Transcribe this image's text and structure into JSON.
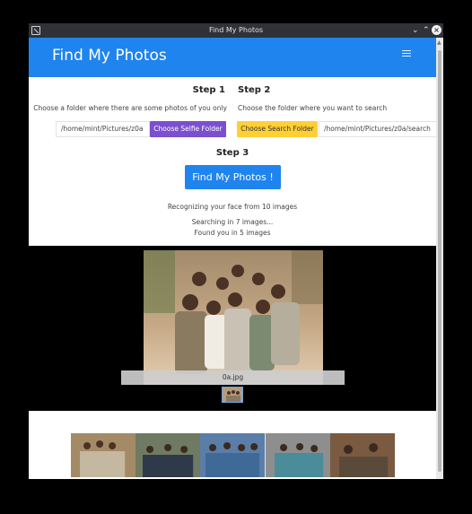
{
  "window": {
    "title": "Find My Photos"
  },
  "navbar": {
    "brand": "Find My Photos"
  },
  "step1": {
    "title": "Step 1",
    "description": "Choose a folder where there are some photos of you only",
    "path": "/home/mint/Pictures/z0a",
    "button": "Choose Selfie Folder"
  },
  "step2": {
    "title": "Step 2",
    "description": "Choose the folder where you want to search",
    "path": "/home/mint/Pictures/z0a/search",
    "button": "Choose Search Folder"
  },
  "step3": {
    "title": "Step 3",
    "button": "Find My Photos !"
  },
  "status": {
    "recognizing": "Recognizing your face from 10 images",
    "searching": "Searching in 7 images...",
    "found": "Found you in 5 images"
  },
  "gallery": {
    "caption": "0a.jpg",
    "thumbnail_count": 1
  },
  "strip": {
    "photo_count": 5
  },
  "colors": {
    "primary": "#1f84ee",
    "selfie_button": "#7b4fcf",
    "search_button": "#ffd035",
    "titlebar": "#2f3236"
  },
  "icons": [
    "app-icon",
    "minimize-icon",
    "maximize-icon",
    "close-icon",
    "hamburger-menu-icon"
  ]
}
